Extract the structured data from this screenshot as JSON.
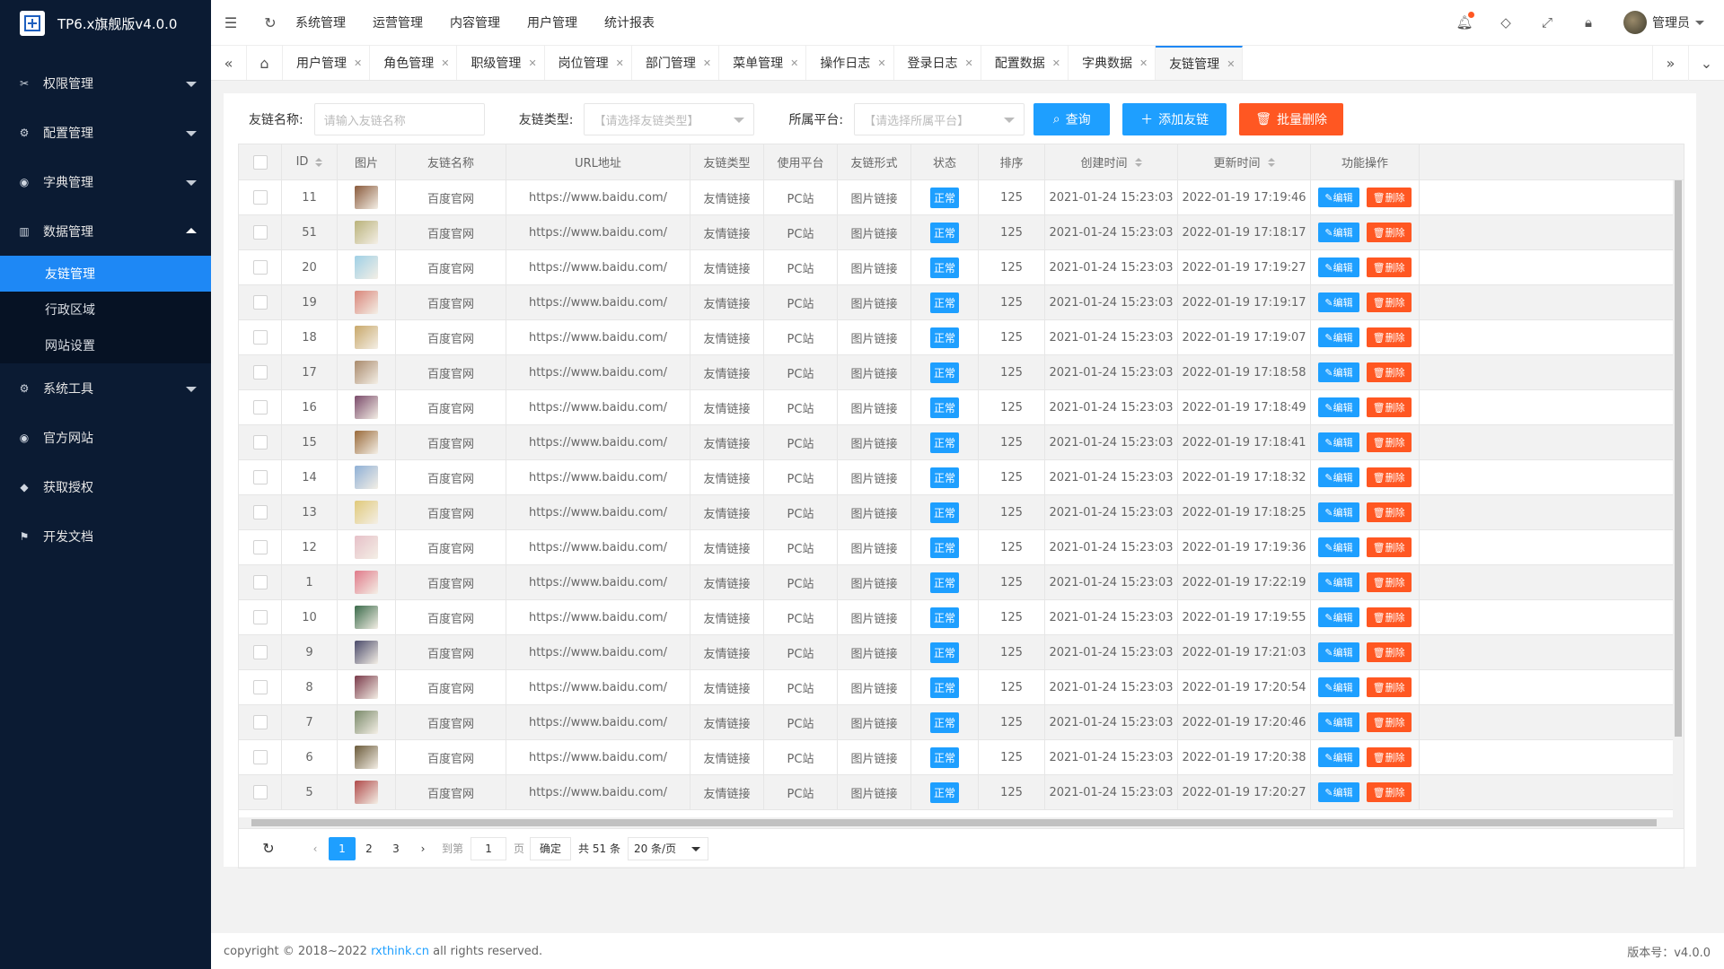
{
  "app": {
    "title": "TP6.x旗舰版v4.0.0"
  },
  "sidebar": {
    "items": [
      {
        "label": "权限管理",
        "icon": "scissors-icon"
      },
      {
        "label": "配置管理",
        "icon": "gear-icon"
      },
      {
        "label": "字典管理",
        "icon": "globe-icon"
      },
      {
        "label": "数据管理",
        "icon": "book-icon",
        "expanded": true,
        "children": [
          {
            "label": "友链管理",
            "active": true
          },
          {
            "label": "行政区域"
          },
          {
            "label": "网站设置"
          }
        ]
      },
      {
        "label": "系统工具",
        "icon": "gear-icon"
      },
      {
        "label": "官方网站",
        "icon": "globe-icon"
      },
      {
        "label": "获取授权",
        "icon": "diamond-icon"
      },
      {
        "label": "开发文档",
        "icon": "flag-icon"
      }
    ]
  },
  "header": {
    "nav": [
      "系统管理",
      "运营管理",
      "内容管理",
      "用户管理",
      "统计报表"
    ],
    "user": "管理员"
  },
  "tabs": {
    "items": [
      "用户管理",
      "角色管理",
      "职级管理",
      "岗位管理",
      "部门管理",
      "菜单管理",
      "操作日志",
      "登录日志",
      "配置数据",
      "字典数据",
      "友链管理"
    ],
    "active": "友链管理"
  },
  "search": {
    "name_label": "友链名称:",
    "name_placeholder": "请输入友链名称",
    "type_label": "友链类型:",
    "type_placeholder": "【请选择友链类型】",
    "platform_label": "所属平台:",
    "platform_placeholder": "【请选择所属平台】",
    "query_btn": "查询",
    "add_btn": "添加友链",
    "batch_delete_btn": "批量删除"
  },
  "table": {
    "headers": [
      "ID",
      "图片",
      "友链名称",
      "URL地址",
      "友链类型",
      "使用平台",
      "友链形式",
      "状态",
      "排序",
      "创建时间",
      "更新时间",
      "功能操作"
    ],
    "edit_label": "编辑",
    "delete_label": "删除",
    "rows": [
      {
        "id": "11",
        "name": "百度官网",
        "url": "https://www.baidu.com/",
        "type": "友情链接",
        "platform": "PC站",
        "form": "图片链接",
        "status": "正常",
        "sort": "125",
        "created": "2021-01-24 15:23:03",
        "updated": "2022-01-19 17:19:46",
        "thumb": "#8a5a3c"
      },
      {
        "id": "51",
        "name": "百度官网",
        "url": "https://www.baidu.com/",
        "type": "友情链接",
        "platform": "PC站",
        "form": "图片链接",
        "status": "正常",
        "sort": "125",
        "created": "2021-01-24 15:23:03",
        "updated": "2022-01-19 17:18:17",
        "thumb": "#b9b27a"
      },
      {
        "id": "20",
        "name": "百度官网",
        "url": "https://www.baidu.com/",
        "type": "友情链接",
        "platform": "PC站",
        "form": "图片链接",
        "status": "正常",
        "sort": "125",
        "created": "2021-01-24 15:23:03",
        "updated": "2022-01-19 17:19:27",
        "thumb": "#9fd0e6"
      },
      {
        "id": "19",
        "name": "百度官网",
        "url": "https://www.baidu.com/",
        "type": "友情链接",
        "platform": "PC站",
        "form": "图片链接",
        "status": "正常",
        "sort": "125",
        "created": "2021-01-24 15:23:03",
        "updated": "2022-01-19 17:19:17",
        "thumb": "#d9867a"
      },
      {
        "id": "18",
        "name": "百度官网",
        "url": "https://www.baidu.com/",
        "type": "友情链接",
        "platform": "PC站",
        "form": "图片链接",
        "status": "正常",
        "sort": "125",
        "created": "2021-01-24 15:23:03",
        "updated": "2022-01-19 17:19:07",
        "thumb": "#c8a86a"
      },
      {
        "id": "17",
        "name": "百度官网",
        "url": "https://www.baidu.com/",
        "type": "友情链接",
        "platform": "PC站",
        "form": "图片链接",
        "status": "正常",
        "sort": "125",
        "created": "2021-01-24 15:23:03",
        "updated": "2022-01-19 17:18:58",
        "thumb": "#a98a6c"
      },
      {
        "id": "16",
        "name": "百度官网",
        "url": "https://www.baidu.com/",
        "type": "友情链接",
        "platform": "PC站",
        "form": "图片链接",
        "status": "正常",
        "sort": "125",
        "created": "2021-01-24 15:23:03",
        "updated": "2022-01-19 17:18:49",
        "thumb": "#7a4a6a"
      },
      {
        "id": "15",
        "name": "百度官网",
        "url": "https://www.baidu.com/",
        "type": "友情链接",
        "platform": "PC站",
        "form": "图片链接",
        "status": "正常",
        "sort": "125",
        "created": "2021-01-24 15:23:03",
        "updated": "2022-01-19 17:18:41",
        "thumb": "#9a6a3a"
      },
      {
        "id": "14",
        "name": "百度官网",
        "url": "https://www.baidu.com/",
        "type": "友情链接",
        "platform": "PC站",
        "form": "图片链接",
        "status": "正常",
        "sort": "125",
        "created": "2021-01-24 15:23:03",
        "updated": "2022-01-19 17:18:32",
        "thumb": "#8fb0d6"
      },
      {
        "id": "13",
        "name": "百度官网",
        "url": "https://www.baidu.com/",
        "type": "友情链接",
        "platform": "PC站",
        "form": "图片链接",
        "status": "正常",
        "sort": "125",
        "created": "2021-01-24 15:23:03",
        "updated": "2022-01-19 17:18:25",
        "thumb": "#e0c97a"
      },
      {
        "id": "12",
        "name": "百度官网",
        "url": "https://www.baidu.com/",
        "type": "友情链接",
        "platform": "PC站",
        "form": "图片链接",
        "status": "正常",
        "sort": "125",
        "created": "2021-01-24 15:23:03",
        "updated": "2022-01-19 17:19:36",
        "thumb": "#e6c0c8"
      },
      {
        "id": "1",
        "name": "百度官网",
        "url": "https://www.baidu.com/",
        "type": "友情链接",
        "platform": "PC站",
        "form": "图片链接",
        "status": "正常",
        "sort": "125",
        "created": "2021-01-24 15:23:03",
        "updated": "2022-01-19 17:22:19",
        "thumb": "#e07a8a"
      },
      {
        "id": "10",
        "name": "百度官网",
        "url": "https://www.baidu.com/",
        "type": "友情链接",
        "platform": "PC站",
        "form": "图片链接",
        "status": "正常",
        "sort": "125",
        "created": "2021-01-24 15:23:03",
        "updated": "2022-01-19 17:19:55",
        "thumb": "#3a6a4a"
      },
      {
        "id": "9",
        "name": "百度官网",
        "url": "https://www.baidu.com/",
        "type": "友情链接",
        "platform": "PC站",
        "form": "图片链接",
        "status": "正常",
        "sort": "125",
        "created": "2021-01-24 15:23:03",
        "updated": "2022-01-19 17:21:03",
        "thumb": "#4a4a6a"
      },
      {
        "id": "8",
        "name": "百度官网",
        "url": "https://www.baidu.com/",
        "type": "友情链接",
        "platform": "PC站",
        "form": "图片链接",
        "status": "正常",
        "sort": "125",
        "created": "2021-01-24 15:23:03",
        "updated": "2022-01-19 17:20:54",
        "thumb": "#7a3a4a"
      },
      {
        "id": "7",
        "name": "百度官网",
        "url": "https://www.baidu.com/",
        "type": "友情链接",
        "platform": "PC站",
        "form": "图片链接",
        "status": "正常",
        "sort": "125",
        "created": "2021-01-24 15:23:03",
        "updated": "2022-01-19 17:20:46",
        "thumb": "#7a8a6a"
      },
      {
        "id": "6",
        "name": "百度官网",
        "url": "https://www.baidu.com/",
        "type": "友情链接",
        "platform": "PC站",
        "form": "图片链接",
        "status": "正常",
        "sort": "125",
        "created": "2021-01-24 15:23:03",
        "updated": "2022-01-19 17:20:38",
        "thumb": "#6a5a3a"
      },
      {
        "id": "5",
        "name": "百度官网",
        "url": "https://www.baidu.com/",
        "type": "友情链接",
        "platform": "PC站",
        "form": "图片链接",
        "status": "正常",
        "sort": "125",
        "created": "2021-01-24 15:23:03",
        "updated": "2022-01-19 17:20:27",
        "thumb": "#b04a4a"
      }
    ]
  },
  "pagination": {
    "pages": [
      "1",
      "2",
      "3"
    ],
    "current": "1",
    "goto_label": "到第",
    "goto_value": "1",
    "page_unit": "页",
    "confirm": "确定",
    "total": "共 51 条",
    "per_page": "20 条/页"
  },
  "footer": {
    "copyright_prefix": "copyright © 2018~2022",
    "link": "rxthink.cn",
    "copyright_suffix": "all rights reserved.",
    "version": "版本号：v4.0.0"
  },
  "colors": {
    "accent": "#1e9fff",
    "danger": "#ff5722",
    "sidebar": "#0b1b33",
    "active_menu": "#1e88f5"
  }
}
